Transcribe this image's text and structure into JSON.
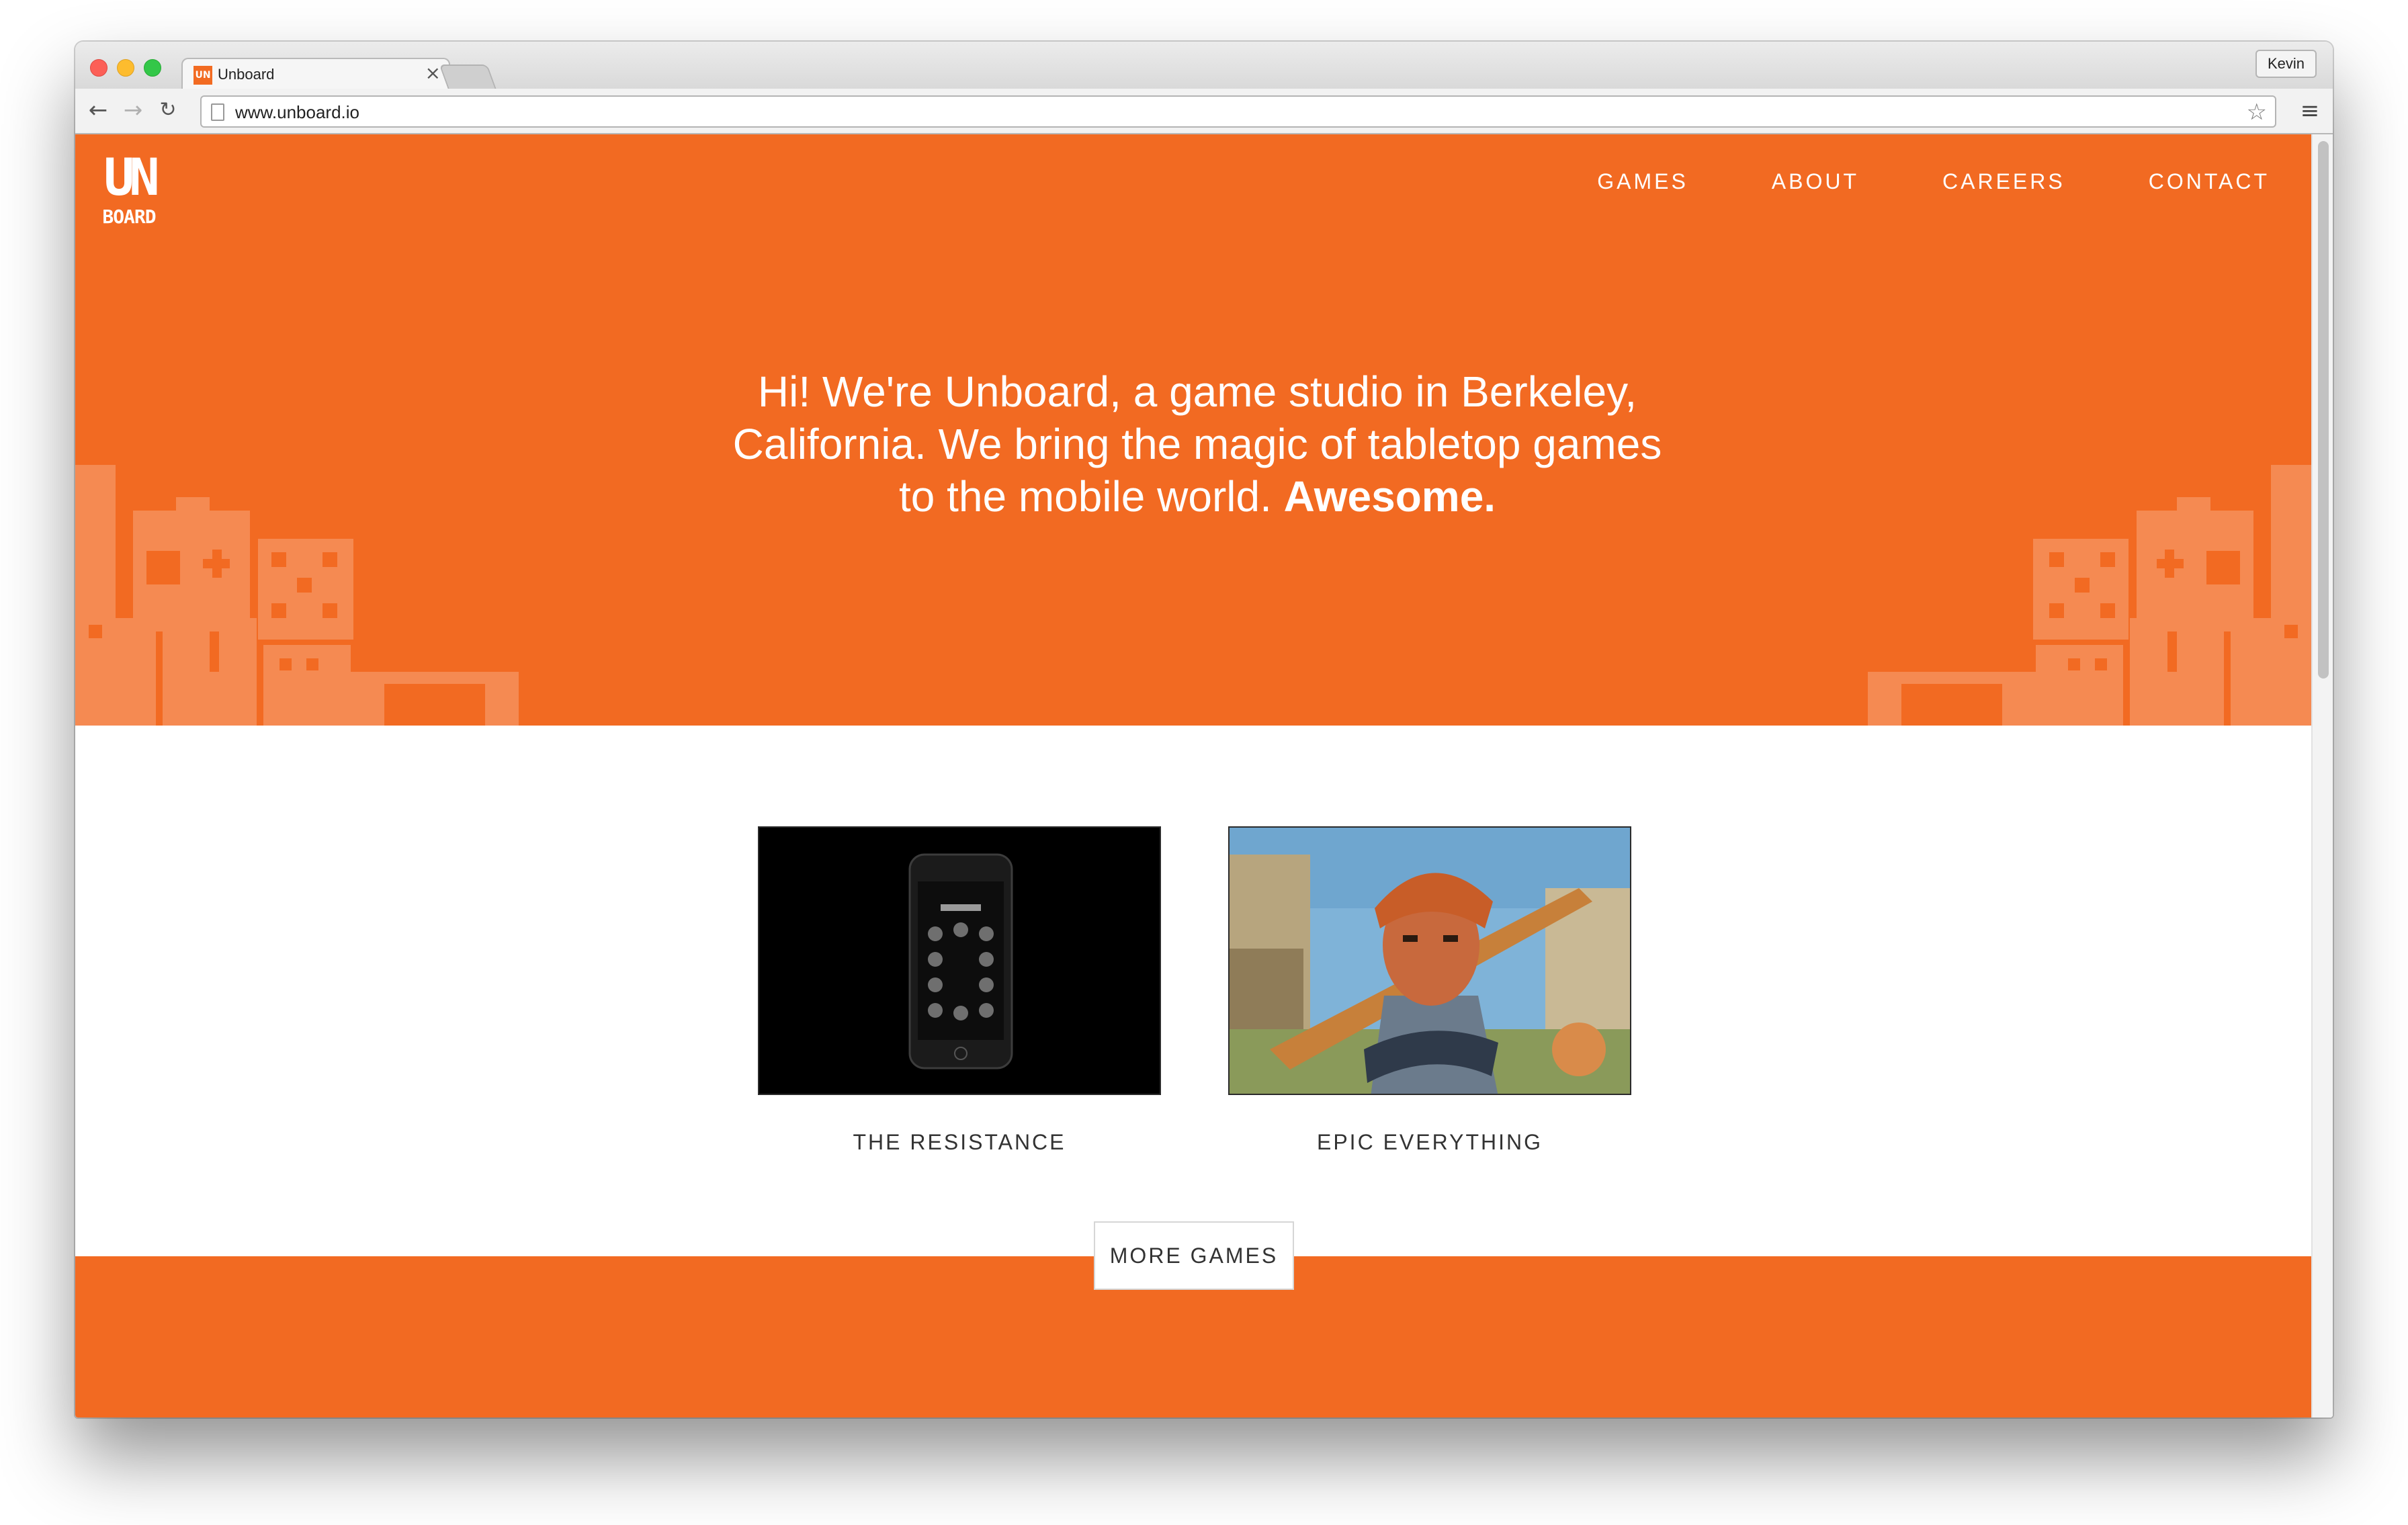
{
  "browser": {
    "tab_title": "Unboard",
    "tab_favicon": "UN",
    "tab_close_icon": "×",
    "profile_name": "Kevin",
    "url": "www.unboard.io",
    "back_icon": "←",
    "forward_icon": "→",
    "reload_icon": "↻",
    "star_icon": "☆",
    "menu_icon": "≡"
  },
  "site": {
    "logo_top": "UN",
    "logo_bottom": "BOARD",
    "nav": [
      "GAMES",
      "ABOUT",
      "CAREERS",
      "CONTACT"
    ],
    "hero_lines": [
      "Hi! We're Unboard, a game studio in Berkeley,",
      "California. We bring the magic of tabletop games",
      "to the mobile world."
    ],
    "hero_emphasis": "Awesome.",
    "games": [
      {
        "title": "THE RESISTANCE",
        "thumbnail": "phone-app-screenshot"
      },
      {
        "title": "EPIC EVERYTHING",
        "thumbnail": "knight-character-art"
      }
    ],
    "more_button": "MORE GAMES"
  },
  "colors": {
    "brand_orange": "#f26a22",
    "decor_orange": "#f58a52"
  }
}
